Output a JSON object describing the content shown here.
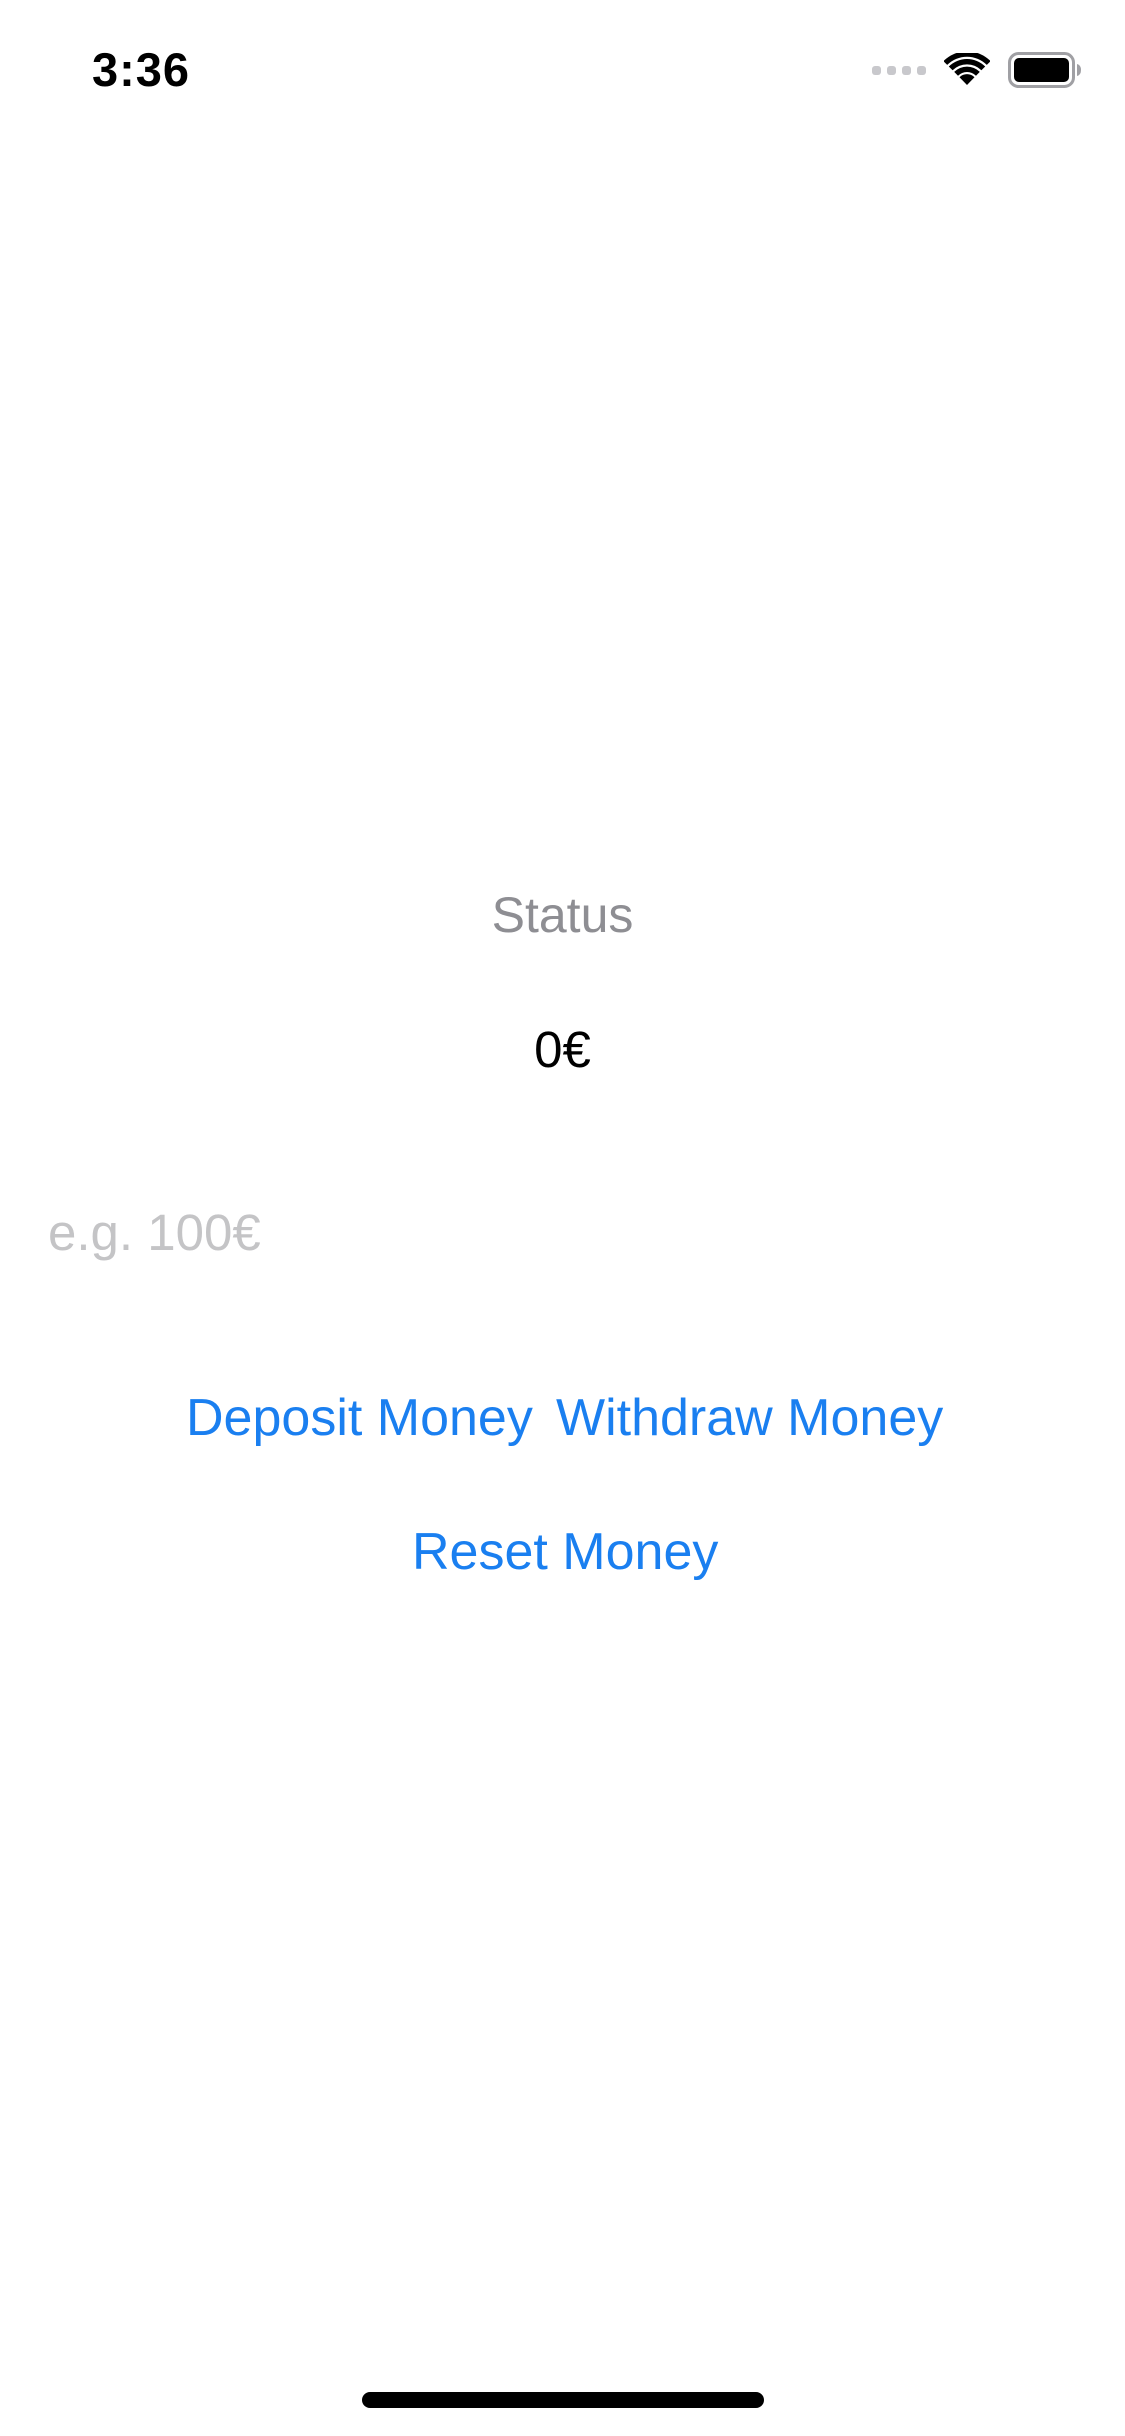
{
  "status_bar": {
    "time": "3:36",
    "signal_icon": "signal-icon",
    "wifi_icon": "wifi-icon",
    "battery_icon": "battery-icon"
  },
  "main": {
    "status_label": "Status",
    "balance": "0€",
    "amount_input": {
      "value": "",
      "placeholder": "e.g. 100€"
    },
    "deposit_label": "Deposit Money",
    "withdraw_label": "Withdraw Money",
    "reset_label": "Reset Money"
  },
  "colors": {
    "accent": "#1a7ff0",
    "secondary_text": "#8e8e93",
    "placeholder": "#c4c4c6"
  }
}
